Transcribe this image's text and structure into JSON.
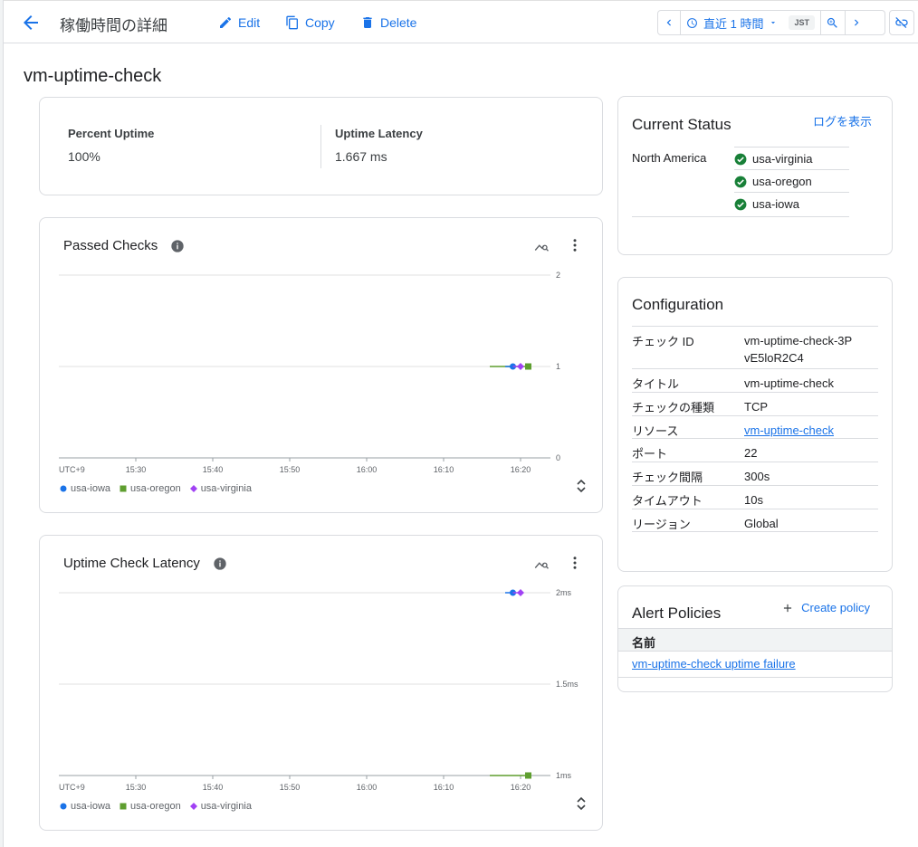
{
  "header": {
    "title": "稼働時間の詳細",
    "edit_label": "Edit",
    "copy_label": "Copy",
    "delete_label": "Delete",
    "time_range": "直近 1 時間",
    "timezone": "JST"
  },
  "check_name": "vm-uptime-check",
  "metrics": [
    {
      "label": "Percent Uptime",
      "value": "100%"
    },
    {
      "label": "Uptime Latency",
      "value": "1.667 ms"
    }
  ],
  "status": {
    "title": "Current Status",
    "logs_link": "ログを表示",
    "region": "North America",
    "locations": [
      "usa-virginia",
      "usa-oregon",
      "usa-iowa"
    ],
    "ok_color": "#188038"
  },
  "configuration": {
    "title": "Configuration",
    "rows": [
      {
        "key": "チェック ID",
        "value": "vm-uptime-check-3PvE5loR2C4"
      },
      {
        "key": "タイトル",
        "value": "vm-uptime-check"
      },
      {
        "key": "チェックの種類",
        "value": "TCP"
      },
      {
        "key": "リソース",
        "value": "vm-uptime-check",
        "link": true
      },
      {
        "key": "ポート",
        "value": "22"
      },
      {
        "key": "チェック間隔",
        "value": "300s"
      },
      {
        "key": "タイムアウト",
        "value": "10s"
      },
      {
        "key": "リージョン",
        "value": "Global"
      }
    ]
  },
  "alert_policies": {
    "title": "Alert Policies",
    "create_label": "Create policy",
    "column": "名前",
    "rows": [
      "vm-uptime-check uptime failure"
    ]
  },
  "legend": [
    {
      "name": "usa-iowa",
      "color": "#1a73e8",
      "shape": "circle"
    },
    {
      "name": "usa-oregon",
      "color": "#5e9e2f",
      "shape": "square"
    },
    {
      "name": "usa-virginia",
      "color": "#a142f4",
      "shape": "diamond"
    }
  ],
  "chart_data": [
    {
      "type": "line",
      "title": "Passed Checks",
      "x_tick_labels": [
        "UTC+9",
        "15:30",
        "15:40",
        "15:50",
        "16:00",
        "16:10",
        "16:20"
      ],
      "y_tick_labels": [
        "2",
        "1",
        "0"
      ],
      "ylim": [
        0,
        2
      ],
      "grid": true,
      "legend_position": "bottom-left",
      "series": [
        {
          "name": "usa-iowa",
          "x": [
            "16:18",
            "16:19"
          ],
          "y": [
            1,
            1
          ]
        },
        {
          "name": "usa-oregon",
          "x": [
            "16:16",
            "16:21"
          ],
          "y": [
            1,
            1
          ]
        },
        {
          "name": "usa-virginia",
          "x": [
            "16:19",
            "16:20"
          ],
          "y": [
            1,
            1
          ]
        }
      ]
    },
    {
      "type": "line",
      "title": "Uptime Check Latency",
      "x_tick_labels": [
        "UTC+9",
        "15:30",
        "15:40",
        "15:50",
        "16:00",
        "16:10",
        "16:20"
      ],
      "y_tick_labels": [
        "2ms",
        "1.5ms",
        "1ms"
      ],
      "ylim": [
        1,
        2
      ],
      "grid": true,
      "legend_position": "bottom-left",
      "series": [
        {
          "name": "usa-iowa",
          "x": [
            "16:18",
            "16:19"
          ],
          "y": [
            2,
            2
          ]
        },
        {
          "name": "usa-oregon",
          "x": [
            "16:16",
            "16:21"
          ],
          "y": [
            1,
            1
          ]
        },
        {
          "name": "usa-virginia",
          "x": [
            "16:19",
            "16:20"
          ],
          "y": [
            2,
            2
          ]
        }
      ]
    }
  ]
}
